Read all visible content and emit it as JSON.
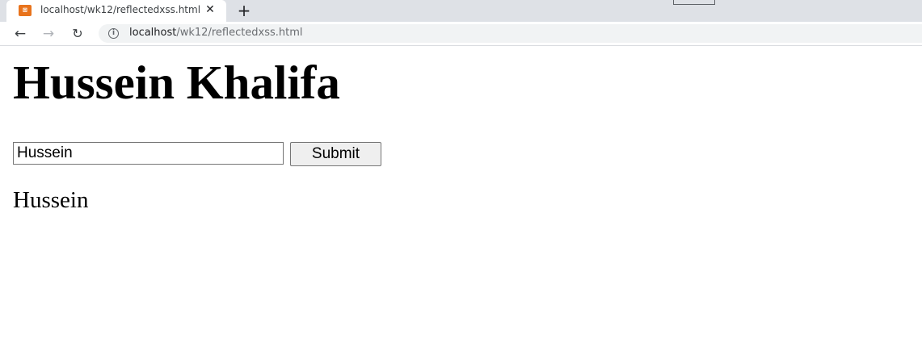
{
  "browser": {
    "tab": {
      "title": "localhost/wk12/reflectedxss.html",
      "close_glyph": "✕",
      "favicon_icon": "xampp-favicon-icon",
      "favicon_glyph": "⊠"
    },
    "new_tab_glyph": "+",
    "nav": {
      "back_glyph": "←",
      "forward_glyph": "→",
      "reload_glyph": "↻"
    },
    "omnibox": {
      "info_glyph": "i",
      "host": "localhost",
      "path": "/wk12/reflectedxss.html"
    }
  },
  "page": {
    "heading": "Hussein Khalifa",
    "form": {
      "input_value": "Hussein",
      "submit_label": "Submit"
    },
    "output": "Hussein"
  }
}
